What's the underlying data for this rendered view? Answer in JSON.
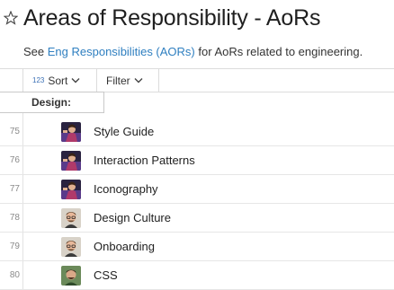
{
  "page": {
    "title": "Areas of Responsibility - AoRs",
    "subtitle_prefix": "See ",
    "subtitle_link": "Eng Responsibilities (AORs)",
    "subtitle_suffix": " for AoRs related to engineering."
  },
  "toolbar": {
    "sort_icon_text": "123",
    "sort_label": "Sort",
    "filter_label": "Filter"
  },
  "group": {
    "label": "Design:"
  },
  "rows": [
    {
      "num": "75",
      "label": "Style Guide",
      "avatar": "avatar-purple-person"
    },
    {
      "num": "76",
      "label": "Interaction Patterns",
      "avatar": "avatar-purple-person"
    },
    {
      "num": "77",
      "label": "Iconography",
      "avatar": "avatar-purple-person"
    },
    {
      "num": "78",
      "label": "Design Culture",
      "avatar": "avatar-man-glasses"
    },
    {
      "num": "79",
      "label": "Onboarding",
      "avatar": "avatar-man-glasses"
    },
    {
      "num": "80",
      "label": "CSS",
      "avatar": "avatar-man-green"
    }
  ],
  "colors": {
    "link": "#2f7fc0",
    "accent": "#3a6fb5"
  }
}
